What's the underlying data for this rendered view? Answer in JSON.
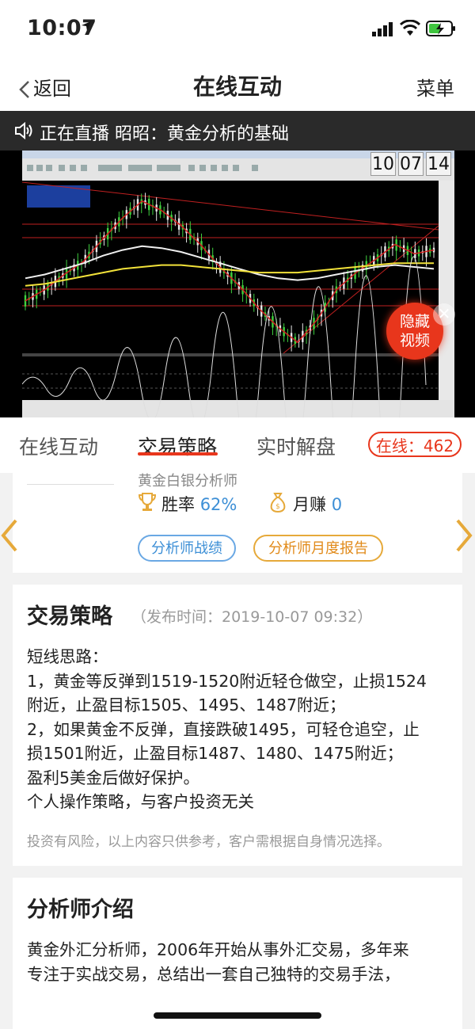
{
  "status": {
    "time": "10:07"
  },
  "nav": {
    "back_label": "返回",
    "title": "在线互动",
    "menu_label": "菜单"
  },
  "live_banner": {
    "text": "正在直播 昭昭：黄金分析的基础"
  },
  "video": {
    "clock": [
      "10",
      "07",
      "14"
    ],
    "hide_label_line1": "隐藏",
    "hide_label_line2": "视频",
    "chart_data": {
      "type": "line",
      "title": "",
      "xlabel": "",
      "ylabel": "",
      "series": [
        {
          "name": "",
          "color": "#d22020",
          "values": [
            1482,
            1488,
            1496,
            1503,
            1515,
            1526,
            1535,
            1530,
            1522,
            1512,
            1500,
            1490,
            1478,
            1468,
            1460,
            1472,
            1488,
            1497,
            1504,
            1512,
            1507,
            1509
          ]
        },
        {
          "name": "",
          "color": "#f0f0f0",
          "values": [
            1494,
            1496,
            1499,
            1502,
            1506,
            1509,
            1511,
            1510,
            1508,
            1505,
            1502,
            1499,
            1496,
            1494,
            1493,
            1494,
            1496,
            1498,
            1500,
            1501,
            1500,
            1499
          ]
        },
        {
          "name": "",
          "color": "#f2e23a",
          "values": [
            1490,
            1491,
            1493,
            1495,
            1497,
            1499,
            1500,
            1501,
            1501,
            1500,
            1499,
            1498,
            1497,
            1497,
            1497,
            1498,
            1499,
            1500,
            1501,
            1502,
            1502,
            1502
          ]
        }
      ],
      "ylim": [
        1455,
        1545
      ],
      "grid": false
    }
  },
  "tabs": {
    "items": [
      {
        "label": "在线互动"
      },
      {
        "label": "交易策略"
      },
      {
        "label": "实时解盘"
      }
    ],
    "online_badge": "在线：462"
  },
  "analyst": {
    "role": "黄金白银分析师",
    "winrate_label": "胜率",
    "winrate_value": "62%",
    "monthly_label": "月赚",
    "monthly_value": "0",
    "btn_record": "分析师战绩",
    "btn_report": "分析师月度报告"
  },
  "strategy": {
    "title": "交易策略",
    "published": "（发布时间：2019-10-07 09:32）",
    "lines": [
      "短线思路：",
      "1，黄金等反弹到1519-1520附近轻仓做空，止损1524",
      "附近，止盈目标1505、1495、1487附近；",
      "2，如果黄金不反弹，直接跌破1495，可轻仓追空，止",
      "损1501附近，止盈目标1487、1480、1475附近；",
      "盈利5美金后做好保护。",
      "个人操作策略，与客户投资无关"
    ],
    "disclaimer": "投资有风险，以上内容只供参考，客户需根据自身情况选择。"
  },
  "intro": {
    "title": "分析师介绍",
    "lines": [
      "黄金外汇分析师，2006年开始从事外汇交易，多年来",
      "专注于实战交易，总结出一套自己独特的交易手法，"
    ]
  },
  "colors": {
    "accent": "#e8361c",
    "blue": "#3d8fd6",
    "orange": "#e18a1a"
  }
}
